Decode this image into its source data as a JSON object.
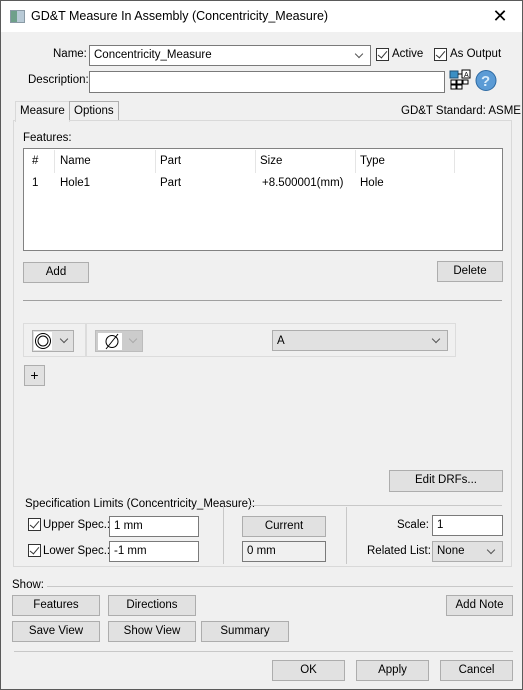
{
  "window": {
    "title": "GD&T Measure In Assembly (Concentricity_Measure)",
    "close_icon": "close-icon"
  },
  "header": {
    "name_label": "Name:",
    "name_value": "Concentricity_Measure",
    "active_label": "Active",
    "active_checked": true,
    "as_output_label": "As Output",
    "as_output_checked": true,
    "description_label": "Description:",
    "description_value": "",
    "icons": [
      "assembly-tree-icon",
      "help-icon"
    ]
  },
  "tabs": [
    {
      "label": "Measure",
      "active": true
    },
    {
      "label": "Options",
      "active": false
    }
  ],
  "gdt_standard": "GD&T Standard: ASME",
  "features": {
    "label": "Features:",
    "columns": [
      "#",
      "Name",
      "Part",
      "Size",
      "Type"
    ],
    "rows": [
      {
        "num": "1",
        "name": "Hole1",
        "part": "Part",
        "size": "+8.500001(mm)",
        "type": "Hole"
      }
    ],
    "add_label": "Add",
    "delete_label": "Delete"
  },
  "fcf": {
    "symbol_icon": "concentricity-icon",
    "modifier_icon": "diameter-icon",
    "datum_value": "A",
    "plus_label": "+"
  },
  "edit_drfs_label": "Edit DRFs...",
  "spec_limits": {
    "title": "Specification Limits (Concentricity_Measure):",
    "upper_label": "Upper Spec.:",
    "upper_checked": true,
    "upper_value": "1 mm",
    "lower_label": "Lower Spec.:",
    "lower_checked": true,
    "lower_value": "-1 mm",
    "current_label": "Current",
    "current_value": "0 mm",
    "scale_label": "Scale:",
    "scale_value": "1",
    "related_list_label": "Related List:",
    "related_list_value": "None"
  },
  "show": {
    "label": "Show:",
    "features_label": "Features",
    "directions_label": "Directions",
    "add_note_label": "Add Note",
    "save_view_label": "Save View",
    "show_view_label": "Show View",
    "summary_label": "Summary"
  },
  "footer": {
    "ok_label": "OK",
    "apply_label": "Apply",
    "cancel_label": "Cancel"
  }
}
